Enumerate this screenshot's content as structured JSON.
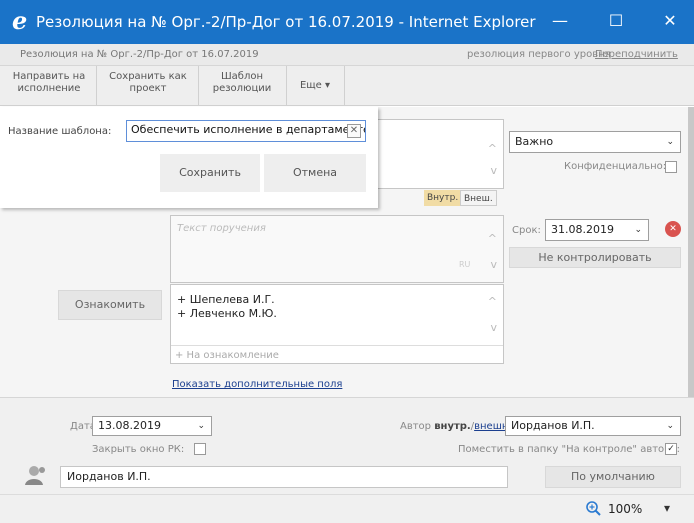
{
  "window": {
    "title": "Резолюция на № Орг.-2/Пр-Дог от 16.07.2019 - Internet Explorer",
    "logo_glyph": "e",
    "minimize_glyph": "—",
    "maximize_glyph": "☐",
    "close_glyph": "✕"
  },
  "subheader": {
    "doc_title": "Резолюция на № Орг.-2/Пр-Дог от 16.07.2019",
    "level": "резолюция первого уровня",
    "reassign_link": "Переподчинить"
  },
  "toolbar": {
    "send_line1": "Направить на",
    "send_line2": "исполнение",
    "save_line1": "Сохранить как",
    "save_line2": "проект",
    "template_line1": "Шаблон",
    "template_line2": "резолюции",
    "more_label": "Еще",
    "more_caret": "▾"
  },
  "template_dialog": {
    "name_label": "Название шаблона:",
    "name_value": "Обеспечить исполнение в департаменте",
    "clear_glyph": "✕",
    "save_label": "Сохранить",
    "cancel_label": "Отмена"
  },
  "form": {
    "importance_value": "Важно",
    "confidential_label": "Конфиденциально:",
    "internal_tab": "Внутр.",
    "external_tab": "Внеш.",
    "task_placeholder": "Текст поручения",
    "task_badge": "RU",
    "deadline_label": "Срок:",
    "deadline_value": "31.08.2019",
    "no_control_label": "Не контролировать",
    "acquaint_button": "Ознакомить",
    "acquaint_list": [
      "+ Шепелева И.Г.",
      "+ Левченко М.Ю."
    ],
    "acquaint_placeholder": "+ На ознакомление",
    "more_fields_link": "Показать дополнительные поля",
    "scroll_up_glyph": "^",
    "scroll_down_glyph": "v",
    "remove_glyph": "✕",
    "caret_glyph": "⌄"
  },
  "bottom": {
    "date_label": "Дата:",
    "date_value": "13.08.2019",
    "close_window_label": "Закрыть окно РК:",
    "author_prefix": "Автор ",
    "author_internal": "внутр.",
    "author_slash": "/",
    "author_external": "внешн.",
    "author_colon": ":",
    "author_value": "Иорданов И.П.",
    "control_folder_label": "Поместить в папку \"На контроле\" автора:",
    "control_folder_check": "✓",
    "signer_value": "Иорданов И.П.",
    "default_button": "По умолчанию"
  },
  "statusbar": {
    "zoom": "100%",
    "zoom_caret": "▾"
  },
  "colors": {
    "titlebar": "#1a73c8",
    "accent_link": "#1b3f8f",
    "danger": "#d9534f",
    "tab_highlight": "#f1dca5"
  }
}
